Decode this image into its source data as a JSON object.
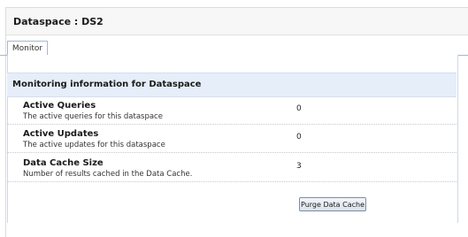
{
  "page": {
    "title": "Dataspace : DS2"
  },
  "tabs": [
    {
      "label": "Monitor"
    }
  ],
  "section": {
    "title": "Monitoring information for Dataspace"
  },
  "metrics": [
    {
      "label": "Active Queries",
      "description": "The active queries for this dataspace",
      "value": "0"
    },
    {
      "label": "Active Updates",
      "description": "The active updates for this dataspace",
      "value": "0"
    },
    {
      "label": "Data Cache Size",
      "description": "Number of results cached in the Data Cache.",
      "value": "3"
    }
  ],
  "actions": {
    "purge_label": "Purge Data Cache"
  }
}
